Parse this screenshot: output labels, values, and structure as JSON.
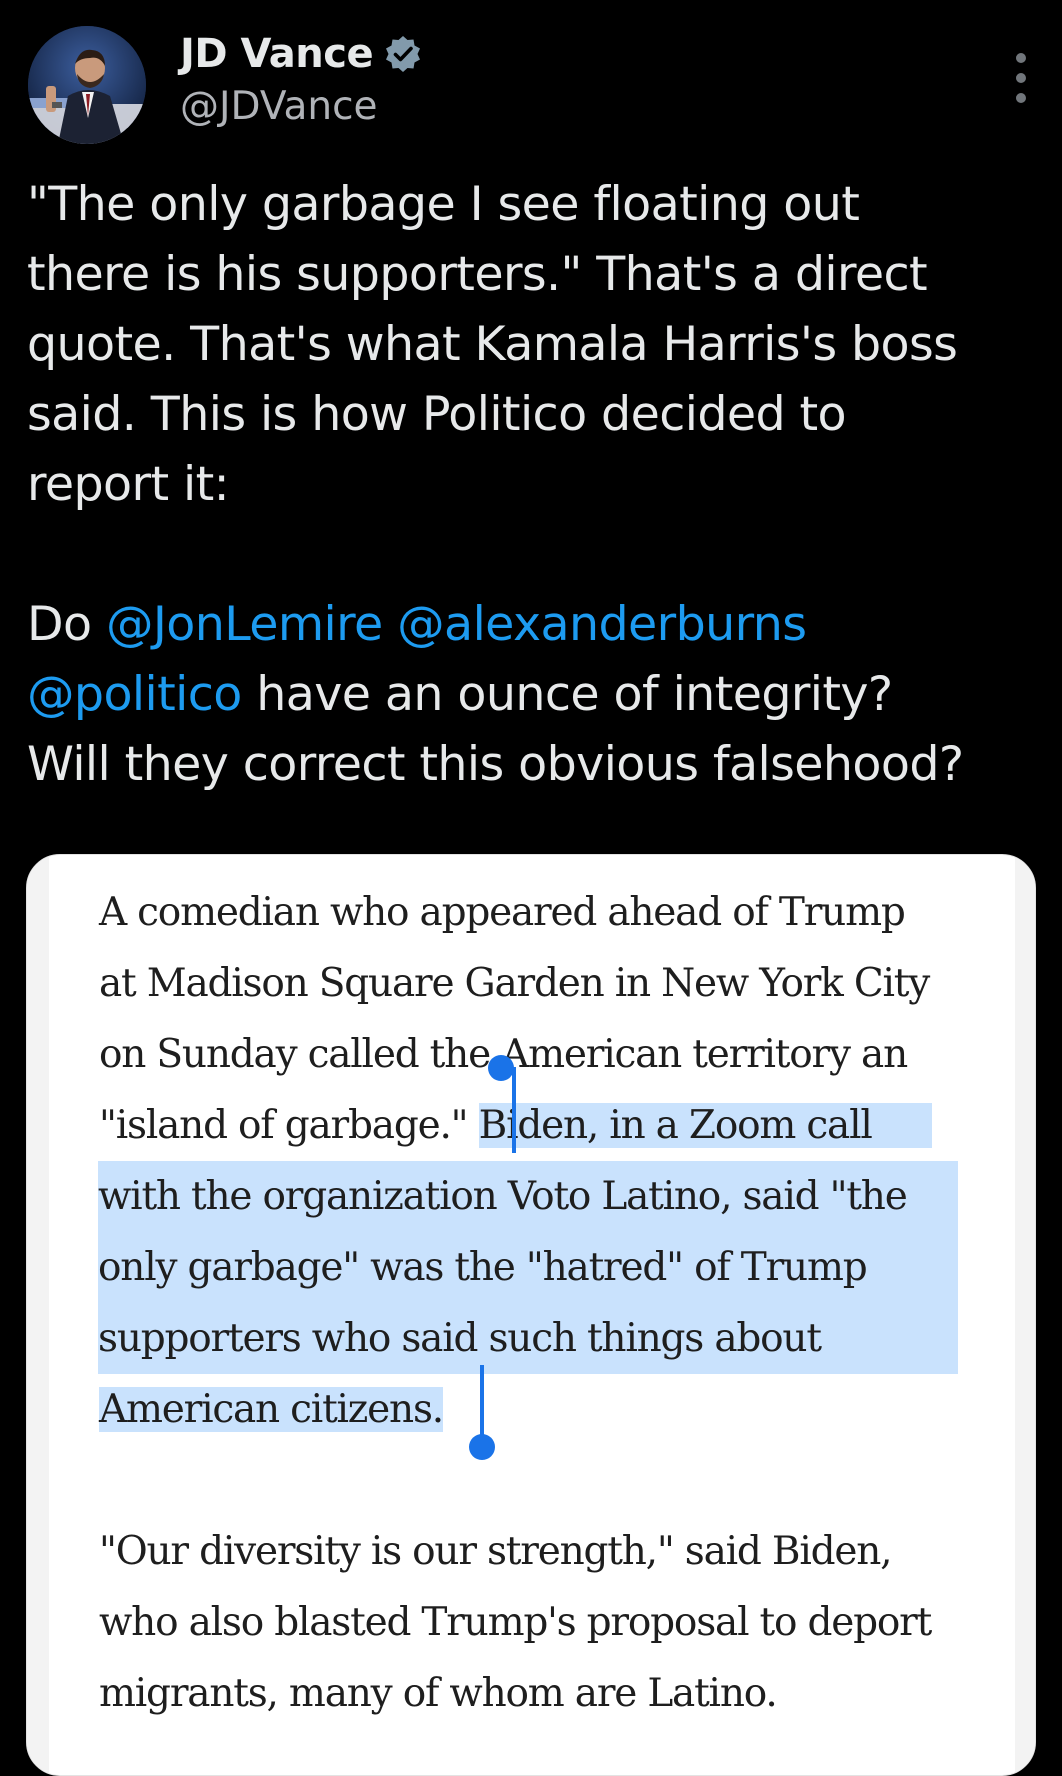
{
  "author": {
    "display_name": "JD Vance",
    "handle": "@JDVance",
    "verified": true,
    "avatar_icon": "profile-photo"
  },
  "tweet": {
    "paragraph1": "\"The only garbage I see floating out there is his supporters.\" That's a direct quote. That's what Kamala Harris's boss said. This is how Politico decided to report it:",
    "paragraph1_lines": [
      "\"The only garbage I see floating out",
      "there is his supporters.\" That's a direct",
      "quote. That's what Kamala Harris's boss",
      "said. This is how Politico decided to",
      "report it:"
    ],
    "do_prefix": "Do ",
    "mentions": [
      "@JonLemire",
      "@alexanderburns",
      "@politico"
    ],
    "after_mentions": " have an ounce of integrity?",
    "last_line": "Will they correct this obvious falsehood?"
  },
  "article": {
    "lines": [
      "A comedian who appeared ahead of Trump",
      "at Madison Square Garden in New York City",
      "on Sunday called the American territory an",
      "\"island of garbage.\" ",
      "Biden, in a Zoom call",
      "with the organization Voto Latino, said \"the",
      "only garbage\" was the \"hatred\" of Trump",
      "supporters who said such things about",
      "American citizens."
    ],
    "para2_lines": [
      "\"Our diversity is our strength,\" said Biden,",
      "who also blasted Trump's proposal to deport",
      "migrants, many of whom are Latino."
    ]
  },
  "colors": {
    "background": "#000000",
    "text": "#e7e9ea",
    "mention": "#1d9bf0",
    "selection": "#c9e2fd",
    "selection_handle": "#1a73e8"
  }
}
